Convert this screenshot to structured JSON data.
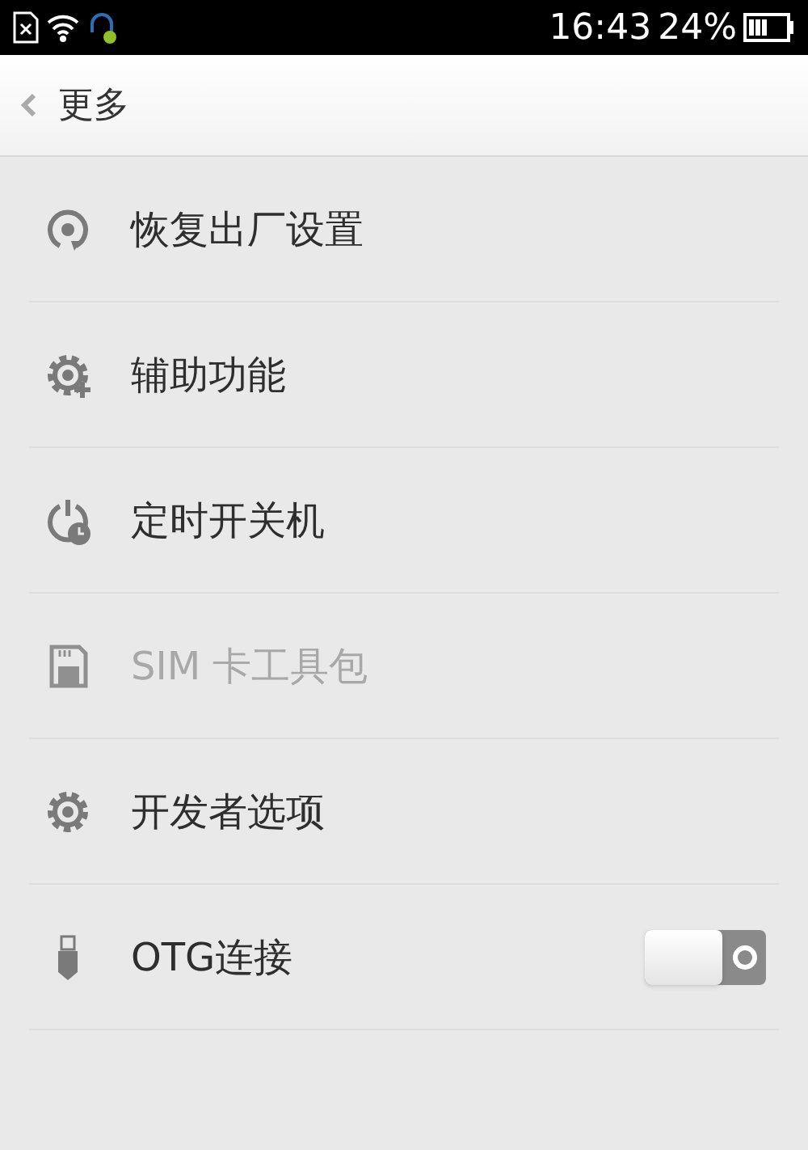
{
  "status_bar": {
    "time": "16:43",
    "battery_percent": "24%"
  },
  "header": {
    "title": "更多"
  },
  "items": [
    {
      "kind": "plain",
      "label": "恢复出厂设置",
      "disabled": false
    },
    {
      "kind": "plain",
      "label": "辅助功能",
      "disabled": false
    },
    {
      "kind": "plain",
      "label": "定时开关机",
      "disabled": false
    },
    {
      "kind": "plain",
      "label": "SIM 卡工具包",
      "disabled": true
    },
    {
      "kind": "plain",
      "label": "开发者选项",
      "disabled": false
    },
    {
      "kind": "toggle",
      "label": "OTG连接",
      "disabled": false,
      "on": false
    }
  ]
}
